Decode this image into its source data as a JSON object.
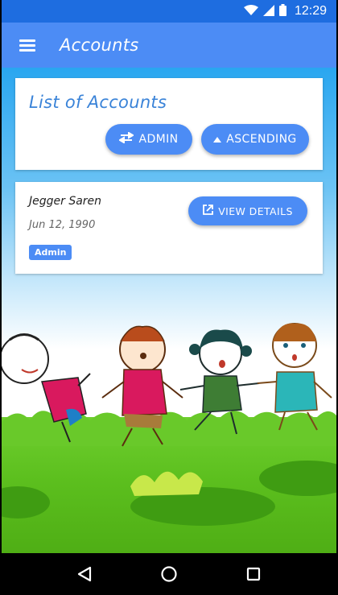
{
  "status_bar": {
    "time": "12:29",
    "icons": [
      "wifi-icon",
      "signal-icon",
      "battery-icon"
    ]
  },
  "app_bar": {
    "title": "Accounts",
    "menu_icon": "hamburger-menu-icon"
  },
  "list_card": {
    "heading": "List of Accounts",
    "filter_button": {
      "label": "ADMIN",
      "icon": "swap-arrows-icon"
    },
    "sort_button": {
      "label": "ASCENDING",
      "icon": "triangle-up-icon"
    }
  },
  "accounts": [
    {
      "name": "Jegger Saren",
      "date": "Jun 12, 1990",
      "role": "Admin",
      "details_button": {
        "label": "VIEW DETAILS",
        "icon": "open-external-icon"
      }
    }
  ],
  "nav_bar": {
    "back_icon": "back-triangle-icon",
    "home_icon": "home-circle-icon",
    "recents_icon": "recents-square-icon"
  },
  "colors": {
    "status_bar": "#1e6de0",
    "app_bar": "#4c8cf5",
    "accent": "#4c8cf5",
    "heading": "#3a83d8"
  }
}
